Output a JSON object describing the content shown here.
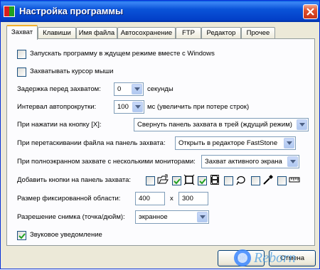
{
  "window": {
    "title": "Настройка программы",
    "accent": "#0a53d8"
  },
  "tabs": [
    {
      "label": "Захват",
      "active": true
    },
    {
      "label": "Клавиши"
    },
    {
      "label": "Имя файла"
    },
    {
      "label": "Автосохранение"
    },
    {
      "label": "FTP"
    },
    {
      "label": "Редактор"
    },
    {
      "label": "Прочее"
    }
  ],
  "capture": {
    "start_minimized_label": "Запускать программу в ждущем режиме вместе с Windows",
    "start_minimized_checked": false,
    "capture_cursor_label": "Захватывать курсор мыши",
    "capture_cursor_checked": false,
    "delay_label": "Задержка перед захватом:",
    "delay_value": "0",
    "delay_unit": "секунды",
    "scroll_interval_label": "Интервал автопрокрутки:",
    "scroll_interval_value": "100",
    "scroll_interval_unit": "мс (увеличить при потере строк)",
    "x_button_label": "При нажатии на кнопку [X]:",
    "x_button_value": "Свернуть панель захвата в трей (ждущий режим)",
    "drag_file_label": "При перетаскивании файла на панель захвата:",
    "drag_file_value": "Открыть в редакторе FastStone",
    "multimonitor_label": "При полноэкранном захвате с несколькими мониторами:",
    "multimonitor_value": "Захват активного экрана",
    "add_buttons_label": "Добавить кнопки на панель захвата:",
    "add_buttons": [
      {
        "icon": "open-folder-icon",
        "checked": false
      },
      {
        "icon": "fixed-region-icon",
        "checked": true
      },
      {
        "icon": "film-icon",
        "checked": true
      },
      {
        "icon": "freehand-icon",
        "checked": false
      },
      {
        "icon": "eyedropper-icon",
        "checked": false
      },
      {
        "icon": "ruler-icon",
        "checked": false
      }
    ],
    "fixed_size_label": "Размер фиксированной области:",
    "fixed_width": "400",
    "fixed_x": "x",
    "fixed_height": "300",
    "resolution_label": "Разрешение снимка (точка/дюйм):",
    "resolution_value": "экранное",
    "sound_label": "Звуковое уведомление",
    "sound_checked": true
  },
  "buttons": {
    "ok_label": "ОК",
    "cancel_label": "Отмена"
  }
}
